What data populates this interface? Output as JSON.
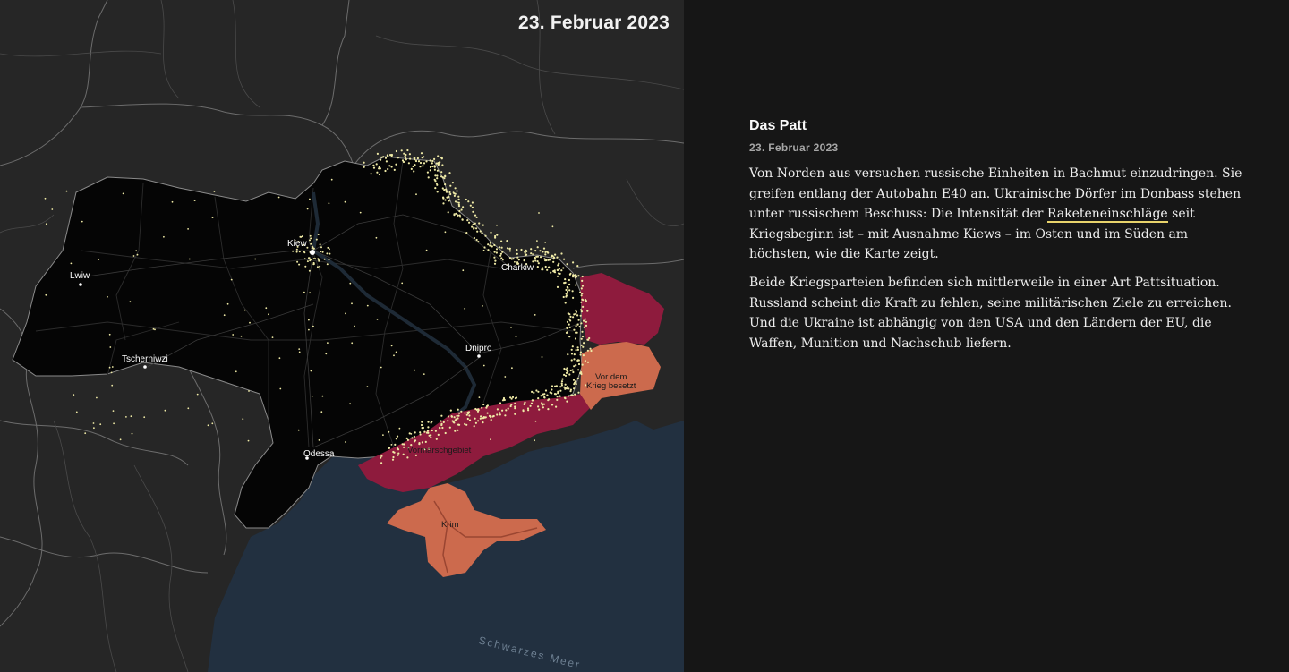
{
  "map": {
    "date_stamp": "23. Februar 2023",
    "labels": {
      "kiew": "Kiew",
      "lwiw": "Lwiw",
      "charkiw": "Charkiw",
      "dnipro": "Dnipro",
      "tscherniwzi": "Tscherniwzi",
      "odessa": "Odessa",
      "vormarschgebiet": "Vormarschgebiet",
      "vor_dem_krieg_1": "Vor dem",
      "vor_dem_krieg_2": "Krieg besetzt",
      "krim": "Krim",
      "sea": "Schwarzes Meer"
    },
    "colors": {
      "background": "#262626",
      "ukraine": "#050505",
      "advance_area": "#8e1b3d",
      "occupied_before_war": "#cc6a4d",
      "sea": "#223040",
      "impacts": "#efeaa6"
    }
  },
  "article": {
    "title": "Das Patt",
    "date": "23. Februar 2023",
    "p1_before": "Von Norden aus versuchen russische Einheiten in Bachmut einzudringen. Sie greifen entlang der Autobahn E40 an. Ukrainische Dörfer im Donbass stehen unter russischem Beschuss: Die Intensität der ",
    "p1_link": "Raketeneinschläge",
    "p1_after": "  seit Kriegsbeginn ist – mit Ausnahme Kiews – im Osten und im Süden am höchsten, wie die Karte zeigt.",
    "p2": "Beide Kriegsparteien befinden sich mittlerweile in einer Art Pattsituation. Russland scheint die Kraft zu fehlen, seine militärischen Ziele zu erreichen. Und die Ukraine ist abhängig von den USA und den Ländern der EU, die Waffen, Munition und Nachschub liefern."
  }
}
